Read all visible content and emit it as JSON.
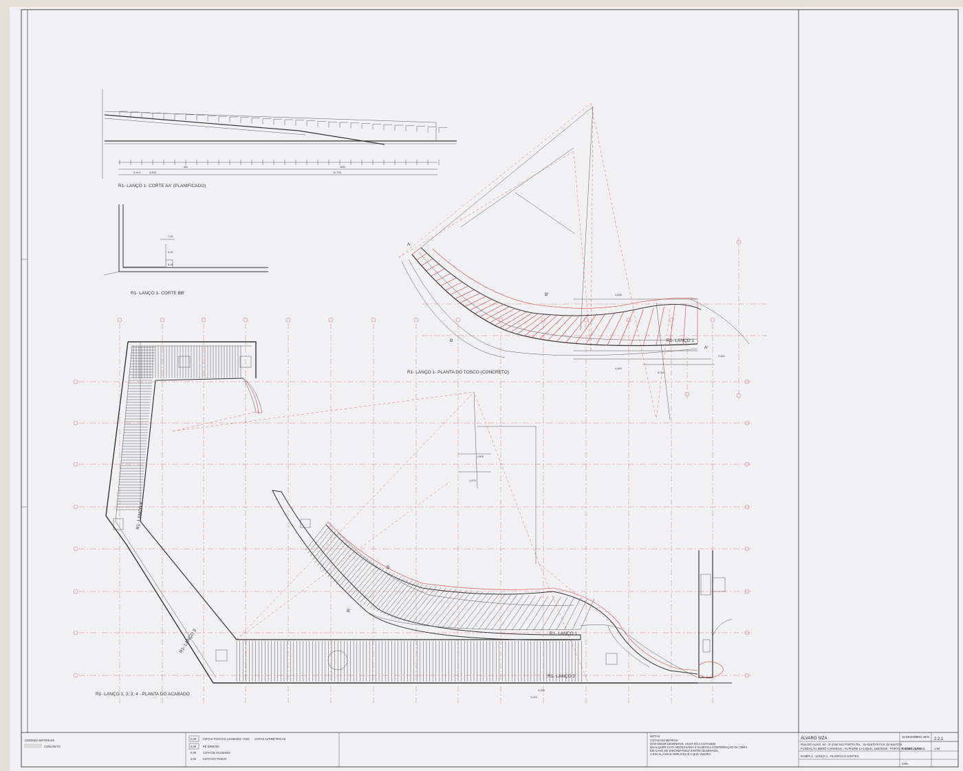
{
  "drawing": {
    "labels": {
      "section_aa": "R1- LANÇO 1- CORTE AA' (PLANIFICADO)",
      "section_bb": "R1- LANÇO 1- CORTE BB'",
      "plan_rough": "R1- LANÇO 1- PLANTA DO TOSCO (CONCRETO)",
      "plan_finish": "R1- LANÇO 1; 2; 3; 4 - PLANTA DO ACABADO"
    },
    "ramp_tags": {
      "rough_l1": "R1- LANÇO 1",
      "finish_l1": "R1- LANÇO 1",
      "finish_l2": "R1- LANÇO 2",
      "finish_l3": "R1- LANÇO 3",
      "finish_l4": "R1- LANÇO 4"
    },
    "dimensions": {
      "aa_total_left": "3,414",
      "aa_mid_a": "4,800",
      "aa_mid_b": "11,790",
      "aa_sub": "6M",
      "aa_sub2": "18M",
      "rough_4800": "4,800",
      "rough_2661": "2,661",
      "rough_5314": "5,314",
      "finish_1800": "1,800",
      "finish_1870": "1,870",
      "finish_5000": "5,000",
      "finish_1220": "1,220"
    },
    "section_marks": {
      "a": "A",
      "a_prime": "A'",
      "b": "B",
      "b_prime": "B'"
    }
  },
  "legend": {
    "title": "LEGENDA MATERIAIS",
    "item": "CONCRETO",
    "symbols": [
      {
        "code": "0,00",
        "text": "COTAS TOSCO E ACABADO"
      },
      {
        "code": "0,00",
        "text": "PÉ DIREITO"
      },
      {
        "code": "0,00",
        "text": "COTA DE ACABADO"
      },
      {
        "code": "0,00",
        "text": "COTA DO TOSCO"
      }
    ],
    "red_symbol": "COTAS ALTIMÉTRICAS"
  },
  "notes": {
    "title": "NOTAS:",
    "lines": [
      "COTAS EM METROS",
      "NÃO MEDIR DESENHOS. USAR SÓ A COTAGEM.",
      "QUALQUER COTA NECESSÁRIA É SUJEITA A CONFIRMAÇÃO DA OBRA.",
      "EM CASO DE DISCREPÂNCIA ENTRE DESENHOS,",
      "A ESCALA MAIS AMPLIADA É A QUE VIGORA."
    ]
  },
  "title_block": {
    "architect": "ÁLVARO SIZA",
    "address": "RUA DO ALIXO, 53 - 2º  4150-043 PORTO   TEL.: 02-6167070   FAX.:02-6167279",
    "project": "FUNDAÇÃO IBERÊ CAMARGO - AV.PADRE CACIQUE, 1830/2040 - PORTO ALEGRE - BRASIL",
    "drawing_title": "RAMPA 1 - LANÇO 1 - PLANTAS E CORTES",
    "date": "16 DEZEMBRO 2004",
    "phase": "P. EXECUÇÃO",
    "sheet_no": "2.2.1",
    "scale": "1:50",
    "rev": "CHK."
  }
}
